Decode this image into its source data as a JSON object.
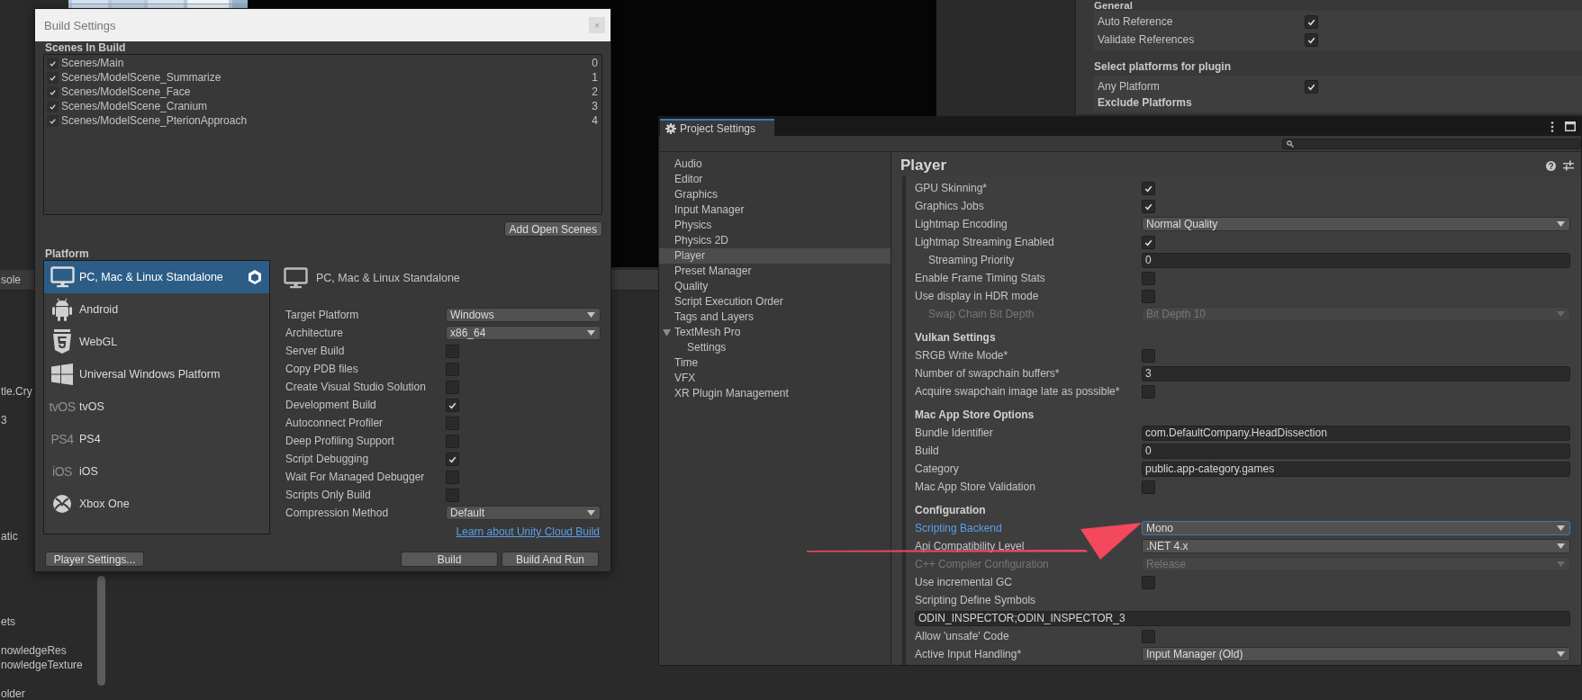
{
  "background": {
    "console_tab": "sole",
    "project_items": [
      "tle.Cry",
      "3",
      "atic",
      "ets",
      "nowledgeRes",
      "nowledgeTexture",
      "older"
    ]
  },
  "inspector": {
    "heading": "General",
    "rows": [
      {
        "label": "Auto Reference",
        "checked": true
      },
      {
        "label": "Validate References",
        "checked": true
      }
    ],
    "platforms_heading": "Select platforms for plugin",
    "platform_rows": [
      {
        "label": "Any Platform",
        "checked": true
      }
    ],
    "exclude_heading": "Exclude Platforms"
  },
  "build_settings": {
    "window": {
      "title": "Build Settings",
      "close": "×"
    },
    "scenes_heading": "Scenes In Build",
    "scenes": [
      {
        "path": "Scenes/Main",
        "index": "0",
        "checked": true
      },
      {
        "path": "Scenes/ModelScene_Summarize",
        "index": "1",
        "checked": true
      },
      {
        "path": "Scenes/ModelScene_Face",
        "index": "2",
        "checked": true
      },
      {
        "path": "Scenes/ModelScene_Cranium",
        "index": "3",
        "checked": true
      },
      {
        "path": "Scenes/ModelScene_PterionApproach",
        "index": "4",
        "checked": true
      }
    ],
    "add_open_scenes": "Add Open Scenes",
    "platform_heading": "Platform",
    "platforms": [
      {
        "label": "PC, Mac & Linux Standalone",
        "kind": "monitor",
        "selected": true,
        "active": true
      },
      {
        "label": "Android",
        "kind": "android",
        "selected": false,
        "active": false
      },
      {
        "label": "WebGL",
        "kind": "html5",
        "selected": false,
        "active": false
      },
      {
        "label": "Universal Windows Platform",
        "kind": "windows",
        "selected": false,
        "active": false
      },
      {
        "label": "tvOS",
        "kind": "text",
        "icon_text": "tvOS",
        "selected": false,
        "active": false
      },
      {
        "label": "PS4",
        "kind": "text",
        "icon_text": "PS4",
        "selected": false,
        "active": false
      },
      {
        "label": "iOS",
        "kind": "text",
        "icon_text": "iOS",
        "selected": false,
        "active": false
      },
      {
        "label": "Xbox One",
        "kind": "xbox",
        "selected": false,
        "active": false
      }
    ],
    "platform_title": "PC, Mac & Linux Standalone",
    "options": [
      {
        "label": "Target Platform",
        "kind": "dropdown",
        "value": "Windows"
      },
      {
        "label": "Architecture",
        "kind": "dropdown",
        "value": "x86_64"
      },
      {
        "label": "Server Build",
        "kind": "check",
        "checked": false
      },
      {
        "label": "Copy PDB files",
        "kind": "check",
        "checked": false
      },
      {
        "label": "Create Visual Studio Solution",
        "kind": "check",
        "checked": false
      },
      {
        "label": "Development Build",
        "kind": "check",
        "checked": true
      },
      {
        "label": "Autoconnect Profiler",
        "kind": "check",
        "checked": false
      },
      {
        "label": "Deep Profiling Support",
        "kind": "check",
        "checked": false
      },
      {
        "label": "Script Debugging",
        "kind": "check",
        "checked": true
      },
      {
        "label": "Wait For Managed Debugger",
        "kind": "check",
        "checked": false
      },
      {
        "label": "Scripts Only Build",
        "kind": "check",
        "checked": false
      },
      {
        "label": "Compression Method",
        "kind": "dropdown",
        "value": "Default"
      }
    ],
    "cloud_link": "Learn about Unity Cloud Build",
    "buttons": {
      "player_settings": "Player Settings...",
      "build": "Build",
      "build_and_run": "Build And Run"
    }
  },
  "project_settings": {
    "tab": "Project Settings",
    "nav": [
      {
        "label": "Audio",
        "selected": false
      },
      {
        "label": "Editor",
        "selected": false
      },
      {
        "label": "Graphics",
        "selected": false
      },
      {
        "label": "Input Manager",
        "selected": false
      },
      {
        "label": "Physics",
        "selected": false
      },
      {
        "label": "Physics 2D",
        "selected": false
      },
      {
        "label": "Player",
        "selected": true
      },
      {
        "label": "Preset Manager",
        "selected": false
      },
      {
        "label": "Quality",
        "selected": false
      },
      {
        "label": "Script Execution Order",
        "selected": false
      },
      {
        "label": "Tags and Layers",
        "selected": false
      },
      {
        "label": "TextMesh Pro",
        "selected": false,
        "expanded": true,
        "children": [
          {
            "label": "Settings",
            "selected": false
          }
        ]
      },
      {
        "label": "Time",
        "selected": false
      },
      {
        "label": "VFX",
        "selected": false
      },
      {
        "label": "XR Plugin Management",
        "selected": false
      }
    ],
    "panel_title": "Player",
    "settings": [
      {
        "label": "GPU Skinning*",
        "kind": "check",
        "checked": true,
        "indent": false,
        "disabled": false
      },
      {
        "label": "Graphics Jobs",
        "kind": "check",
        "checked": true,
        "indent": false,
        "disabled": false
      },
      {
        "label": "Lightmap Encoding",
        "kind": "dropdown",
        "value": "Normal Quality",
        "indent": false,
        "disabled": false,
        "focused": false
      },
      {
        "label": "Lightmap Streaming Enabled",
        "kind": "check",
        "checked": true,
        "indent": false,
        "disabled": false
      },
      {
        "label": "Streaming Priority",
        "kind": "input",
        "value": "0",
        "indent": true,
        "disabled": false
      },
      {
        "label": "Enable Frame Timing Stats",
        "kind": "check",
        "checked": false,
        "indent": false,
        "disabled": false
      },
      {
        "label": "Use display in HDR mode",
        "kind": "check",
        "checked": false,
        "indent": false,
        "disabled": false
      },
      {
        "label": "Swap Chain Bit Depth",
        "kind": "dropdown",
        "value": "Bit Depth 10",
        "indent": true,
        "disabled": true,
        "focused": false
      },
      {
        "label": "Vulkan Settings",
        "kind": "header"
      },
      {
        "label": "SRGB Write Mode*",
        "kind": "check",
        "checked": false,
        "indent": false,
        "disabled": false
      },
      {
        "label": "Number of swapchain buffers*",
        "kind": "input",
        "value": "3",
        "indent": false,
        "disabled": false
      },
      {
        "label": "Acquire swapchain image late as possible*",
        "kind": "check",
        "checked": false,
        "indent": false,
        "disabled": false
      },
      {
        "label": "Mac App Store Options",
        "kind": "header"
      },
      {
        "label": "Bundle Identifier",
        "kind": "input",
        "value": "com.DefaultCompany.HeadDissection",
        "indent": false,
        "disabled": false
      },
      {
        "label": "Build",
        "kind": "input",
        "value": "0",
        "indent": false,
        "disabled": false
      },
      {
        "label": "Category",
        "kind": "input",
        "value": "public.app-category.games",
        "indent": false,
        "disabled": false
      },
      {
        "label": "Mac App Store Validation",
        "kind": "check",
        "checked": false,
        "indent": false,
        "disabled": false
      },
      {
        "label": "Configuration",
        "kind": "header"
      },
      {
        "label": "Scripting Backend",
        "kind": "dropdown",
        "value": "Mono",
        "indent": false,
        "disabled": false,
        "focused": true
      },
      {
        "label": "Api Compatibility Level",
        "kind": "dropdown",
        "value": ".NET 4.x",
        "indent": false,
        "disabled": false,
        "focused": false
      },
      {
        "label": "C++ Compiler Configuration",
        "kind": "dropdown",
        "value": "Release",
        "indent": false,
        "disabled": true,
        "focused": false
      },
      {
        "label": "Use incremental GC",
        "kind": "check",
        "checked": false,
        "indent": false,
        "disabled": false
      },
      {
        "label": "Scripting Define Symbols",
        "kind": "label"
      },
      {
        "kind": "wide-input",
        "value": "ODIN_INSPECTOR;ODIN_INSPECTOR_3"
      },
      {
        "label": "Allow 'unsafe' Code",
        "kind": "check",
        "checked": false,
        "indent": false,
        "disabled": false
      },
      {
        "label": "Active Input Handling*",
        "kind": "dropdown",
        "value": "Input Manager (Old)",
        "indent": false,
        "disabled": false,
        "focused": false
      }
    ]
  }
}
